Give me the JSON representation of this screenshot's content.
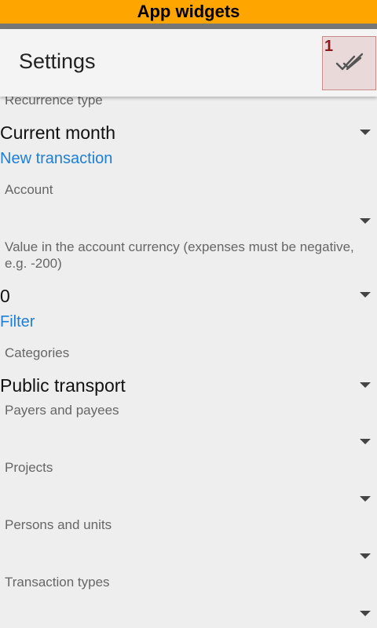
{
  "topbar": {
    "title": "App widgets"
  },
  "header": {
    "title": "Settings",
    "confirm_badge": "1",
    "confirm_icon": "double-check-icon"
  },
  "fields": {
    "recurrence_type": {
      "label": "Recurrence type",
      "value": "Current month"
    },
    "new_transaction_section": "New transaction",
    "account": {
      "label": "Account",
      "value": ""
    },
    "value_in_currency": {
      "label": "Value in the account currency (expenses must be negative, e.g. -200)",
      "value": "0"
    },
    "filter_section": "Filter",
    "categories": {
      "label": "Categories",
      "value": "Public transport"
    },
    "payers_and_payees": {
      "label": "Payers and payees",
      "value": ""
    },
    "projects": {
      "label": "Projects",
      "value": ""
    },
    "persons_and_units": {
      "label": "Persons and units",
      "value": ""
    },
    "transaction_types": {
      "label": "Transaction types",
      "value": ""
    }
  },
  "colors": {
    "topbar": "#ffa500",
    "section_link": "#1e7ed6",
    "badge": "#8b1a1a"
  }
}
